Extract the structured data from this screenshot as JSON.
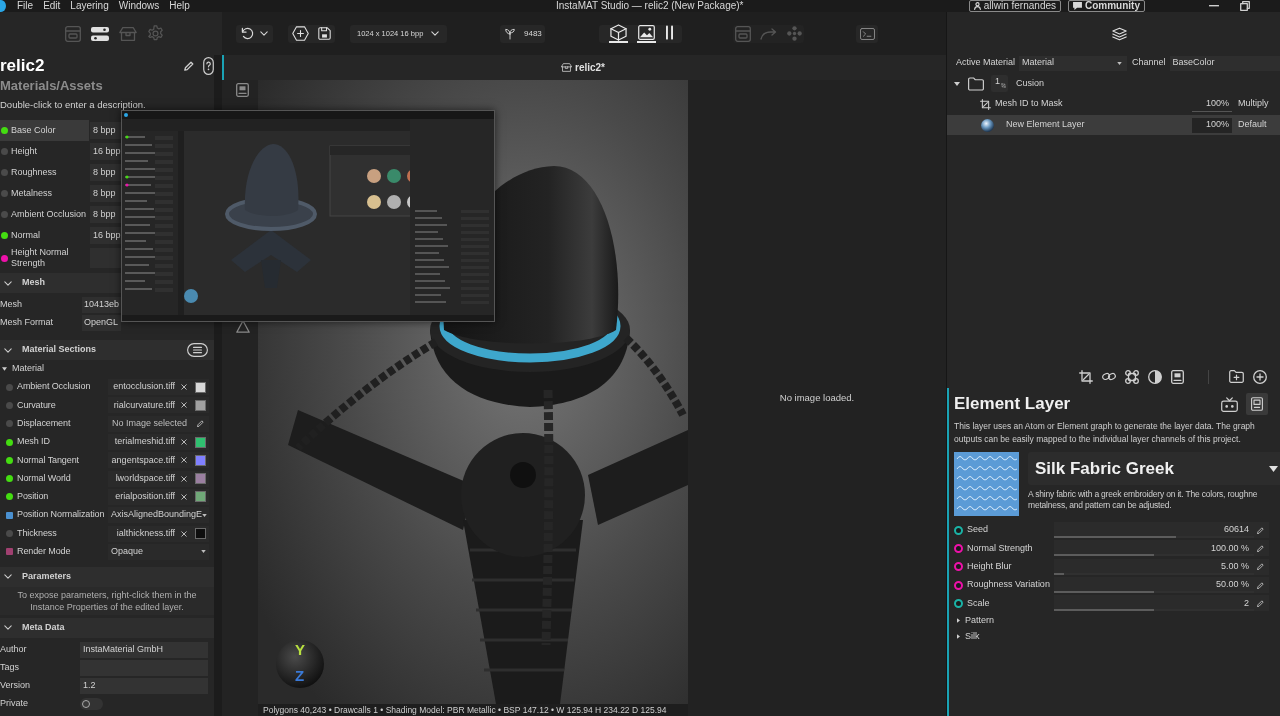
{
  "menu_bar": {
    "menus": [
      "File",
      "Edit",
      "Layering",
      "Windows",
      "Help"
    ],
    "title": "InstaMAT Studio — relic2 (New Package)*",
    "user": "allwin fernandes",
    "community": "Community"
  },
  "toolbar": {
    "panel_tools": [
      {
        "kind": "bake",
        "disabled": true
      },
      {
        "kind": "layout",
        "disabled": false
      },
      {
        "kind": "package",
        "disabled": true
      },
      {
        "kind": "settings",
        "disabled": true
      }
    ],
    "resolution": "1024 x 1024 16 bpp",
    "seed": "9483",
    "view_modes": [
      {
        "kind": "scene",
        "selected": true
      },
      {
        "kind": "image",
        "selected": true
      },
      {
        "kind": "split",
        "selected": false
      }
    ],
    "render_tools": [
      {
        "kind": "bake",
        "disabled": true
      },
      {
        "kind": "export",
        "disabled": true
      },
      {
        "kind": "nodes",
        "disabled": true
      }
    ]
  },
  "material": {
    "name": "relic2",
    "path": "Materials/Assets",
    "description": "Double-click to enter a description.",
    "channels": [
      {
        "name": "Base Color",
        "format": "8 bpp",
        "color": "#44dd11",
        "selected": true
      },
      {
        "name": "Height",
        "format": "16 bpp",
        "color": "#4a4a4a",
        "selected": false
      },
      {
        "name": "Roughness",
        "format": "8 bpp",
        "color": "#4a4a4a",
        "selected": false
      },
      {
        "name": "Metalness",
        "format": "8 bpp",
        "color": "#4a4a4a",
        "selected": false
      },
      {
        "name": "Ambient Occlusion",
        "format": "8 bpp",
        "color": "#4a4a4a",
        "selected": false
      },
      {
        "name": "Normal",
        "format": "16 bpp",
        "color": "#44dd11",
        "selected": false
      },
      {
        "name": "Height Normal Strength",
        "color": "#ee11aa",
        "selected": false
      }
    ]
  },
  "mesh": {
    "title": "Mesh",
    "expanded": true,
    "rows": [
      {
        "label": "Mesh",
        "value": "10413eb"
      },
      {
        "label": "Mesh Format",
        "value": "OpenGL"
      }
    ]
  },
  "material_sections": {
    "title": "Material Sections",
    "expanded": true,
    "group": {
      "name": "Material",
      "expanded": true
    },
    "rows": [
      {
        "kind": "image",
        "label": "Ambient Occlusion",
        "value": "entocclusion.tiff",
        "marker": {
          "kind": "dot",
          "color": "#4a4a4a"
        },
        "thumbnail": {
          "color": "#d8d8d8"
        }
      },
      {
        "kind": "image",
        "label": "Curvature",
        "value": "rialcurvature.tiff",
        "marker": {
          "kind": "dot",
          "color": "#4a4a4a"
        },
        "thumbnail": {
          "color": "#a0a0a0"
        }
      },
      {
        "kind": "empty",
        "label": "Displacement",
        "value": "No Image selected",
        "marker": {
          "kind": "dot",
          "color": "#4a4a4a"
        }
      },
      {
        "kind": "image",
        "label": "Mesh ID",
        "value": "terialmeshid.tiff",
        "marker": {
          "kind": "dot",
          "color": "#44dd11"
        },
        "thumbnail": {
          "color": "#30c070"
        }
      },
      {
        "kind": "image",
        "label": "Normal Tangent",
        "value": "angentspace.tiff",
        "marker": {
          "kind": "dot",
          "color": "#44dd11"
        },
        "thumbnail": {
          "color": "#8080ff"
        }
      },
      {
        "kind": "image",
        "label": "Normal World",
        "value": "lworldspace.tiff",
        "marker": {
          "kind": "dot",
          "color": "#44dd11"
        },
        "thumbnail": {
          "color": "#9a7fa0"
        }
      },
      {
        "kind": "image",
        "label": "Position",
        "value": "erialposition.tiff",
        "marker": {
          "kind": "dot",
          "color": "#44dd11"
        },
        "thumbnail": {
          "color": "#70a878"
        }
      },
      {
        "kind": "dropdown",
        "label": "Position Normalization",
        "value": "AxisAlignedBoundingE",
        "marker": {
          "kind": "square",
          "color": "#4a90d0"
        }
      },
      {
        "kind": "image",
        "label": "Thickness",
        "value": "ialthickness.tiff",
        "marker": {
          "kind": "dot",
          "color": "#4a4a4a"
        },
        "thumbnail": {
          "color": "#0e0e0e"
        }
      },
      {
        "kind": "dropdown",
        "label": "Render Mode",
        "value": "Opaque",
        "marker": {
          "kind": "square",
          "color": "#a04070"
        }
      }
    ]
  },
  "parameters": {
    "title": "Parameters",
    "expanded": true,
    "hint": "To expose parameters, right-click them in the Instance Properties of the edited layer."
  },
  "meta_data": {
    "title": "Meta Data",
    "expanded": true,
    "fields": [
      {
        "kind": "text",
        "label": "Author",
        "value": "InstaMaterial GmbH"
      },
      {
        "kind": "text",
        "label": "Tags"
      },
      {
        "kind": "text",
        "label": "Version",
        "value": "1.2"
      },
      {
        "kind": "toggle",
        "label": "Private",
        "on": false
      }
    ]
  },
  "document_tab": {
    "title": "relic2*"
  },
  "viewport": {
    "axes": [
      "Y",
      "Z"
    ],
    "status": "Polygons 40,243 • Drawcalls 1 • Shading Model: PBR Metallic • BSP 147.12 • W 125.94 H 234.22 D 125.94"
  },
  "image_view": {
    "message": "No image loaded."
  },
  "layers_panel": {
    "active_material_label": "Active Material",
    "active_material": "Material",
    "channel_label": "Channel",
    "channel": "BaseColor",
    "layers": [
      {
        "kind": "folder",
        "badge": "1",
        "name": "Cusion",
        "expanded": true,
        "selected": false,
        "children": [
          {
            "kind": "mask",
            "name": "Mesh ID to Mask",
            "opacity": "100%",
            "blend": "Multiply",
            "selected": false
          },
          {
            "kind": "element",
            "name": "New Element Layer",
            "opacity": "100%",
            "blend": "Default",
            "selected": true
          }
        ]
      }
    ]
  },
  "properties": {
    "title": "Element Layer",
    "description": "This layer uses an Atom or Element graph to generate the layer data. The graph outputs can be easily mapped to the individual layer channels of this project.",
    "graph": {
      "name": "Silk Fabric Greek",
      "description_lines": [
        "A shiny fabric with a greek embroidery on it. The colors, roughne",
        "metalness, and pattern can be adjusted."
      ]
    },
    "parameters": [
      {
        "name": "Seed",
        "value": "60614",
        "level": 0.61,
        "color": "#1ab3a6"
      },
      {
        "name": "Normal Strength",
        "value": "100.00 %",
        "level": 0.5,
        "color": "#ee11aa"
      },
      {
        "name": "Height Blur",
        "value": "5.00 %",
        "level": 0.05,
        "color": "#ee11aa"
      },
      {
        "name": "Roughness Variation",
        "value": "50.00 %",
        "level": 0.5,
        "color": "#ee11aa"
      },
      {
        "name": "Scale",
        "value": "2",
        "level": 0.5,
        "color": "#1ab3a6"
      }
    ],
    "groups": [
      {
        "name": "Pattern",
        "expanded": false
      },
      {
        "name": "Silk",
        "expanded": false
      }
    ]
  }
}
